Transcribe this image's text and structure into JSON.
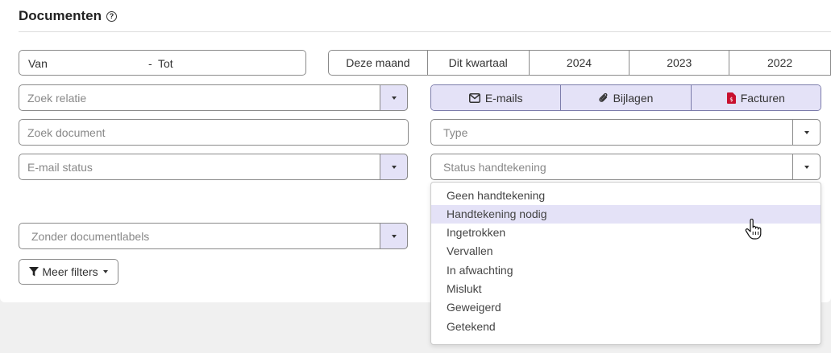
{
  "header": {
    "title": "Documenten",
    "help_icon": "question-circle-icon"
  },
  "date_range": {
    "from_placeholder": "Van",
    "separator": "-",
    "to_placeholder": "Tot"
  },
  "periods": [
    "Deze maand",
    "Dit kwartaal",
    "2024",
    "2023",
    "2022"
  ],
  "filters": {
    "relation_placeholder": "Zoek relatie",
    "document_placeholder": "Zoek document",
    "email_status_placeholder": "E-mail status",
    "labels_placeholder": "Zonder documentlabels",
    "type_placeholder": "Type",
    "signature_status_placeholder": "Status handtekening"
  },
  "toggles": {
    "emails": "E-mails",
    "attachments": "Bijlagen",
    "invoices": "Facturen"
  },
  "more_filters": "Meer filters",
  "signature_dropdown": {
    "options": [
      "Geen handtekening",
      "Handtekening nodig",
      "Ingetrokken",
      "Vervallen",
      "In afwachting",
      "Mislukt",
      "Geweigerd",
      "Getekend"
    ],
    "highlighted": "Handtekening nodig"
  },
  "colors": {
    "accent_bg": "#e4e2f7",
    "pdf_red": "#c8102e"
  }
}
